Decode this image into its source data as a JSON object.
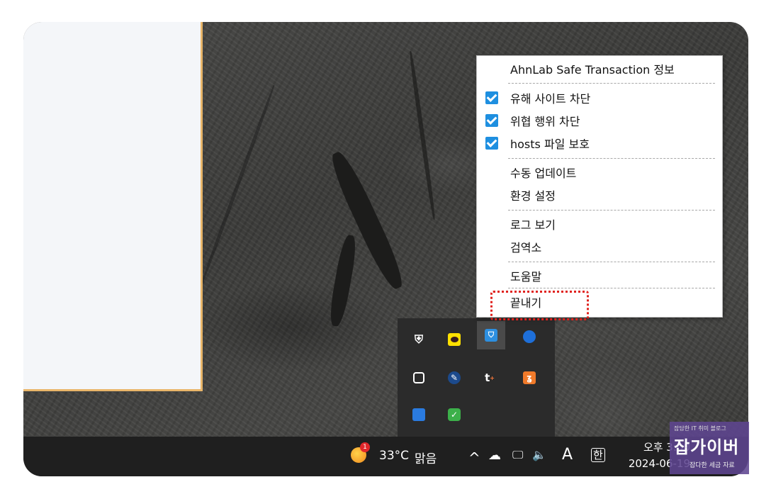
{
  "context_menu": {
    "items": [
      {
        "label": "AhnLab Safe Transaction 정보",
        "checked": false
      },
      {
        "label": "유해 사이트 차단",
        "checked": true
      },
      {
        "label": "위협 행위 차단",
        "checked": true
      },
      {
        "label": "hosts 파일 보호",
        "checked": true
      },
      {
        "label": "수동 업데이트",
        "checked": false
      },
      {
        "label": "환경 설정",
        "checked": false
      },
      {
        "label": "로그 보기",
        "checked": false
      },
      {
        "label": "검역소",
        "checked": false
      },
      {
        "label": "도움말",
        "checked": false
      },
      {
        "label": "끝내기",
        "checked": false,
        "highlighted": true
      }
    ],
    "check_color": "#1e8fe0",
    "highlight_color": "#e0221e"
  },
  "tray_overflow": {
    "icons": [
      "windows-security-warning-icon",
      "kakaotalk-icon",
      "ahnlab-safe-transaction-icon",
      "blue-app-icon",
      "camera-icon",
      "wrench-tool-icon",
      "t-plus-icon",
      "orange-app-icon",
      "blue-folder-icon",
      "green-check-icon"
    ]
  },
  "taskbar": {
    "weather": {
      "badge": "1",
      "temp": "33°C",
      "condition": "맑음"
    },
    "tray_symbols": {
      "chevron": "^",
      "ime": "A",
      "hangul": "한"
    },
    "clock": {
      "time": "오후 3:00",
      "date": "2024-06-19"
    }
  },
  "watermark": {
    "top": "잡담한 IT 취미 블로그",
    "main": "잡가이버",
    "sub": "잡다한 세금 자료"
  }
}
